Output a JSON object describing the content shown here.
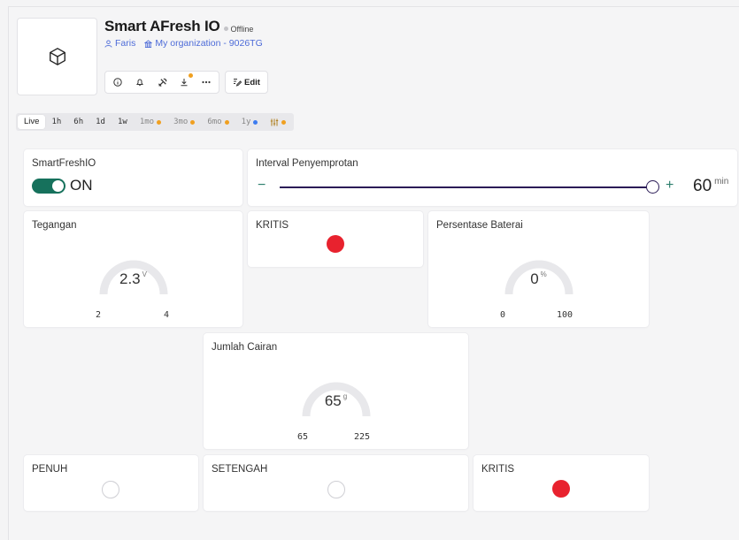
{
  "device": {
    "title": "Smart AFresh IO",
    "status": "Offline",
    "owner": "Faris",
    "organization": "My organization - 9026TG",
    "edit_label": "Edit",
    "icons": [
      "box-icon",
      "info-icon",
      "bell-icon",
      "tools-icon",
      "download-icon",
      "more-icon",
      "edit-icon"
    ]
  },
  "time_tabs": [
    {
      "label": "Live",
      "active": true
    },
    {
      "label": "1h"
    },
    {
      "label": "6h"
    },
    {
      "label": "1d"
    },
    {
      "label": "1w"
    },
    {
      "label": "1mo",
      "dot": "#f0a020",
      "dim": true
    },
    {
      "label": "3mo",
      "dot": "#f0a020",
      "dim": true
    },
    {
      "label": "6mo",
      "dot": "#f0a020",
      "dim": true
    },
    {
      "label": "1y",
      "dot": "#3d7cf0",
      "dim": true
    },
    {
      "label": "",
      "dot": "#f0a020",
      "icon": "sliders-icon"
    }
  ],
  "widgets": {
    "smartfreshio": {
      "title": "SmartFreshIO",
      "state": "ON"
    },
    "interval": {
      "title": "Interval Penyemprotan",
      "value": "60",
      "unit": "min",
      "minus": "−",
      "plus": "+"
    },
    "tegangan": {
      "title": "Tegangan",
      "value": "2.3",
      "unit": "V",
      "min": "2",
      "max": "4"
    },
    "kritis_top": {
      "title": "KRITIS",
      "led": "on"
    },
    "baterai": {
      "title": "Persentase Baterai",
      "value": "0",
      "unit": "%",
      "min": "0",
      "max": "100"
    },
    "cairan": {
      "title": "Jumlah Cairan",
      "value": "65",
      "unit": "g",
      "min": "65",
      "max": "225"
    },
    "penuh": {
      "title": "PENUH",
      "led": "off"
    },
    "setengah": {
      "title": "SETENGAH",
      "led": "off"
    },
    "kritis_bottom": {
      "title": "KRITIS",
      "led": "on"
    }
  },
  "colors": {
    "accent": "#16715c",
    "led_on": "#e8222e",
    "slider": "#2b1c57",
    "link": "#4d6bd8"
  }
}
